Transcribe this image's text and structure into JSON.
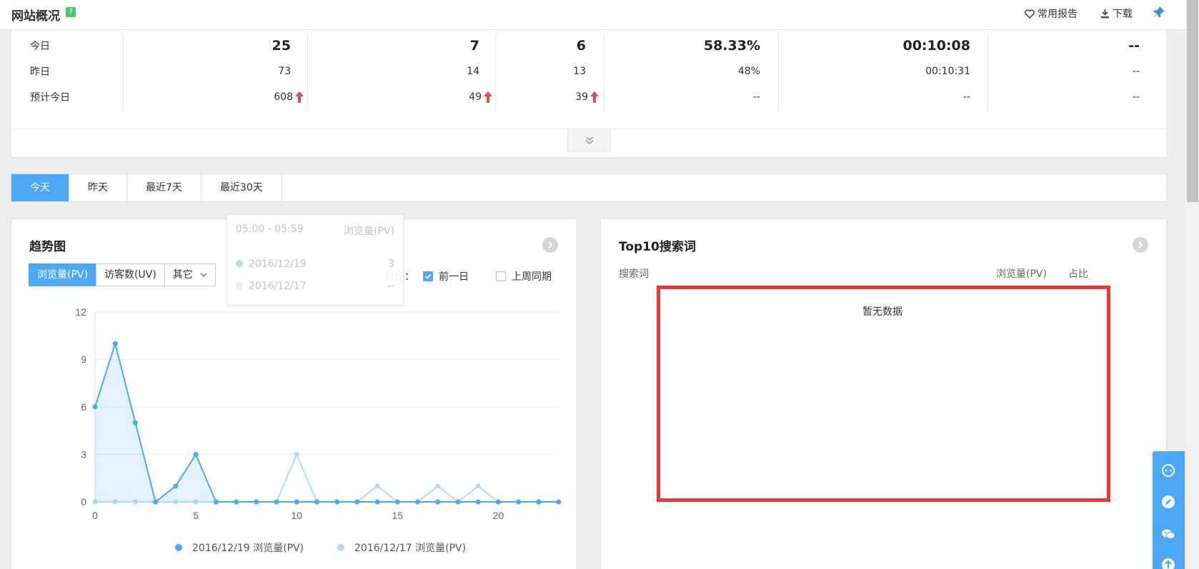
{
  "header": {
    "title": "网站概况",
    "help": "?",
    "favorites_label": "常用报告",
    "download_label": "下载"
  },
  "stats": {
    "rows": [
      {
        "label": "今日",
        "values": [
          "25",
          "7",
          "6",
          "58.33%",
          "00:10:08",
          "--"
        ],
        "arrows": [
          false,
          false,
          false,
          false,
          false,
          false
        ]
      },
      {
        "label": "昨日",
        "values": [
          "73",
          "14",
          "13",
          "48%",
          "00:10:31",
          "--"
        ],
        "arrows": [
          false,
          false,
          false,
          false,
          false,
          false
        ]
      },
      {
        "label": "预计今日",
        "values": [
          "608",
          "49",
          "39",
          "--",
          "--",
          "--"
        ],
        "arrows": [
          true,
          true,
          true,
          false,
          false,
          false
        ]
      }
    ]
  },
  "tabs": [
    "今天",
    "昨天",
    "最近7天",
    "最近30天"
  ],
  "trend": {
    "title": "趋势图",
    "metrics": [
      "浏览量(PV)",
      "访客数(UV)",
      "其它"
    ],
    "compare_label": "对比：",
    "compare_options": [
      {
        "label": "前一日",
        "checked": true
      },
      {
        "label": "上周同期",
        "checked": false
      }
    ],
    "tooltip": {
      "time": "05:00 - 05:59",
      "metric": "浏览量(PV)",
      "rows": [
        {
          "date": "2016/12/19",
          "value": "3",
          "color": "#4ca8f5"
        },
        {
          "date": "2016/12/17",
          "value": "--",
          "color": "#b3dafb"
        }
      ]
    }
  },
  "chart_data": {
    "type": "line",
    "x": [
      0,
      1,
      2,
      3,
      4,
      5,
      6,
      7,
      8,
      9,
      10,
      11,
      12,
      13,
      14,
      15,
      16,
      17,
      18,
      19,
      20,
      21,
      22,
      23
    ],
    "x_ticks": [
      0,
      5,
      10,
      15,
      20
    ],
    "y_ticks": [
      0,
      3,
      6,
      9,
      12
    ],
    "ylim": [
      0,
      12
    ],
    "grid": true,
    "legend": "bottom",
    "series": [
      {
        "name": "2016/12/19 浏览量(PV)",
        "color": "#4ca8f5",
        "fill": true,
        "values": [
          6,
          10,
          5,
          0,
          1,
          3,
          0,
          0,
          0,
          0,
          0,
          0,
          0,
          0,
          0,
          0,
          0,
          0,
          0,
          0,
          0,
          0,
          0,
          0
        ]
      },
      {
        "name": "2016/12/17 浏览量(PV)",
        "color": "#b3dafb",
        "fill": false,
        "values": [
          0,
          0,
          0,
          0,
          0,
          0,
          0,
          0,
          0,
          0,
          3,
          0,
          0,
          0,
          1,
          0,
          0,
          1,
          0,
          1,
          0,
          0,
          0,
          0
        ]
      }
    ]
  },
  "search": {
    "title": "Top10搜索词",
    "col_keyword": "搜索词",
    "col_pv": "浏览量(PV)",
    "col_ratio": "占比",
    "empty": "暂无数据"
  }
}
